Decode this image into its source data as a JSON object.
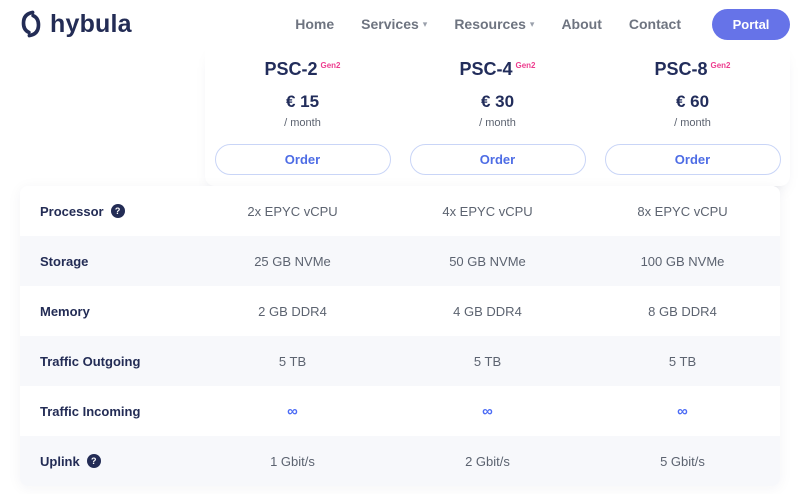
{
  "brand": {
    "name": "hybula"
  },
  "nav": {
    "items": [
      {
        "label": "Home"
      },
      {
        "label": "Services"
      },
      {
        "label": "Resources"
      },
      {
        "label": "About"
      },
      {
        "label": "Contact"
      }
    ],
    "portal_label": "Portal"
  },
  "plans": [
    {
      "name": "PSC-2",
      "badge": "Gen2",
      "price": "€ 15",
      "period": "/ month",
      "order_label": "Order"
    },
    {
      "name": "PSC-4",
      "badge": "Gen2",
      "price": "€ 30",
      "period": "/ month",
      "order_label": "Order"
    },
    {
      "name": "PSC-8",
      "badge": "Gen2",
      "price": "€ 60",
      "period": "/ month",
      "order_label": "Order"
    }
  ],
  "specs": {
    "rows": [
      {
        "label": "Processor",
        "help": true,
        "values": [
          "2x EPYC vCPU",
          "4x EPYC vCPU",
          "8x EPYC vCPU"
        ]
      },
      {
        "label": "Storage",
        "help": false,
        "values": [
          "25 GB NVMe",
          "50 GB NVMe",
          "100 GB NVMe"
        ]
      },
      {
        "label": "Memory",
        "help": false,
        "values": [
          "2 GB DDR4",
          "4 GB DDR4",
          "8 GB DDR4"
        ]
      },
      {
        "label": "Traffic Outgoing",
        "help": false,
        "values": [
          "5 TB",
          "5 TB",
          "5 TB"
        ]
      },
      {
        "label": "Traffic Incoming",
        "help": false,
        "values": [
          "∞",
          "∞",
          "∞"
        ]
      },
      {
        "label": "Uplink",
        "help": true,
        "values": [
          "1 Gbit/s",
          "2 Gbit/s",
          "5 Gbit/s"
        ]
      }
    ]
  },
  "icons": {
    "help": "?",
    "chevron": "▾"
  },
  "colors": {
    "navy": "#232c55",
    "portal_indigo": "#6673e8",
    "order_blue": "#4d6ce5",
    "order_border": "#c9d5f7",
    "badge_pink": "#ed3d8f",
    "row_alt_bg": "#f7f8fb",
    "value_gray": "#5c6370",
    "nav_gray": "#6e7480",
    "infinity_blue": "#4b6bf5"
  }
}
